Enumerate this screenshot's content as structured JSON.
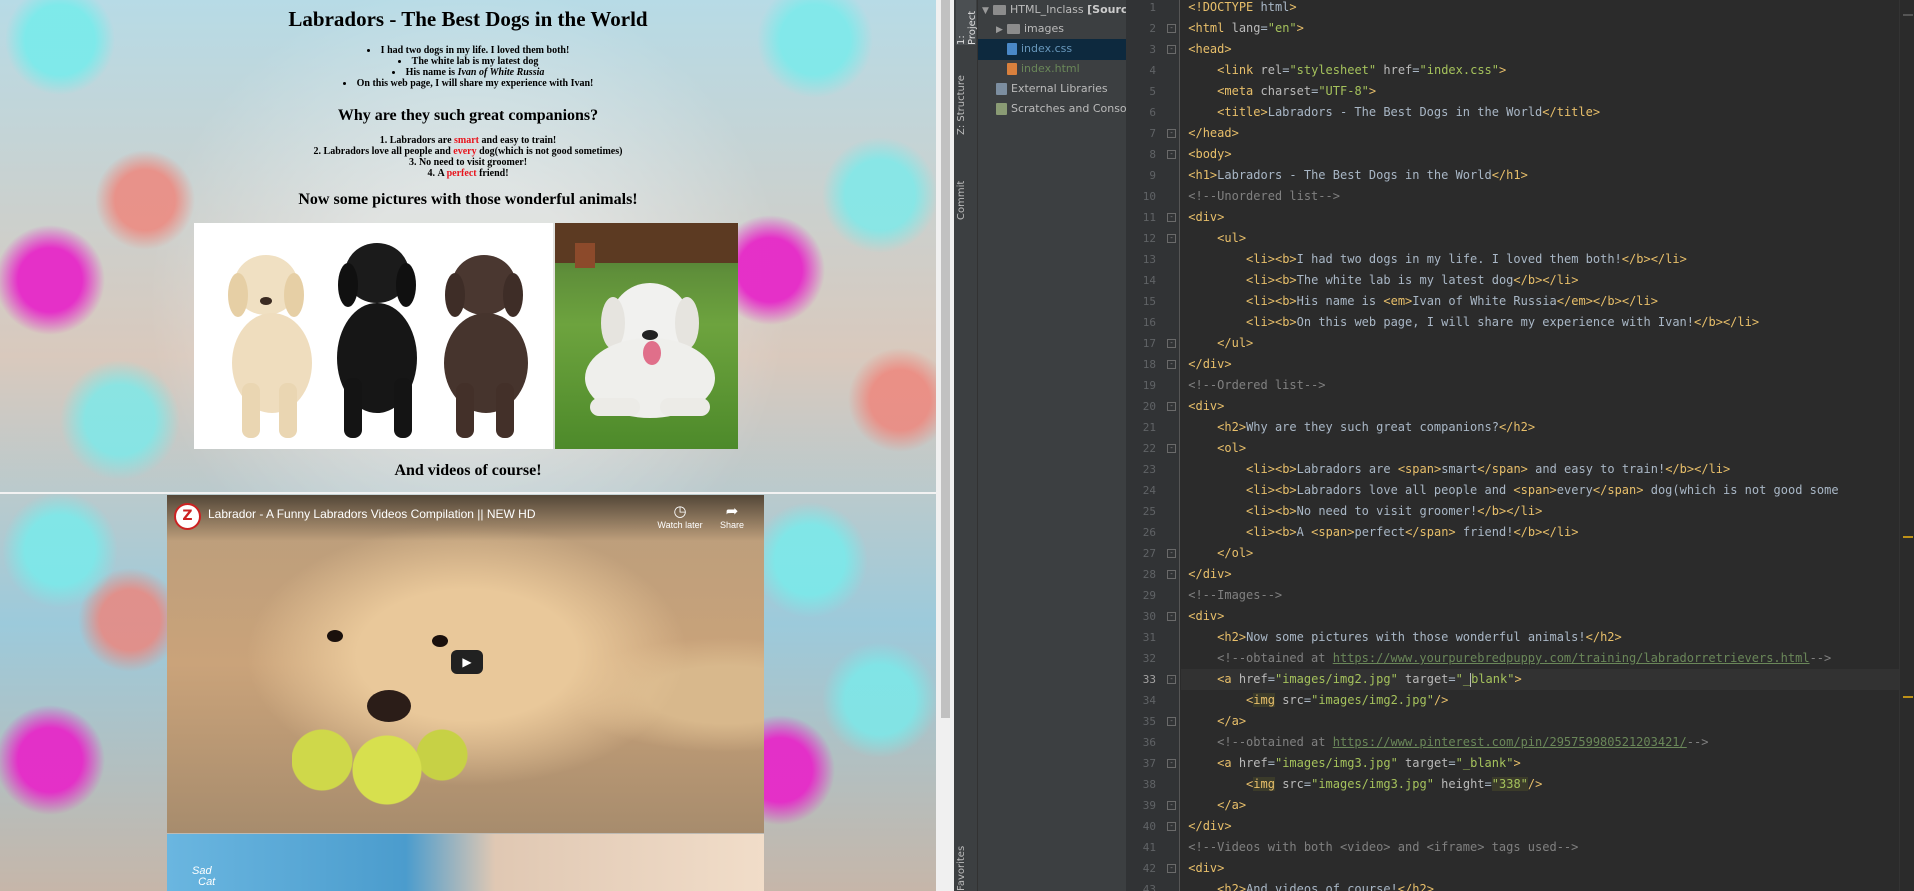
{
  "browser": {
    "h1": "Labradors - The Best Dogs in the World",
    "list": [
      {
        "pre": "I had two dogs in my life. I loved them both!",
        "em": "",
        "post": ""
      },
      {
        "pre": "The white lab is my latest dog",
        "em": "",
        "post": ""
      },
      {
        "pre": "His name is ",
        "em": "Ivan of White Russia",
        "post": ""
      },
      {
        "pre": "On this web page, I will share my experience with Ivan!",
        "em": "",
        "post": ""
      }
    ],
    "h2_companions": "Why are they such great companions?",
    "ordered": [
      {
        "pre": "Labradors are ",
        "red": "smart",
        "post": " and easy to train!"
      },
      {
        "pre": "Labradors love all people and ",
        "red": "every",
        "post": " dog(which is not good sometimes)"
      },
      {
        "pre": "No need to visit groomer!",
        "red": "",
        "post": ""
      },
      {
        "pre": "A ",
        "red": "perfect",
        "post": " friend!"
      }
    ],
    "h2_pictures": "Now some pictures with those wonderful animals!",
    "h2_videos": "And videos of course!",
    "video": {
      "title": "Labrador - A Funny Labradors Videos Compilation || NEW HD",
      "watch_later": "Watch later",
      "share": "Share",
      "second_video_text_1": "Sad",
      "second_video_text_2": "Cat"
    }
  },
  "ide": {
    "tool_windows": {
      "project": "1: Project",
      "structure": "Z: Structure",
      "commit": "Commit",
      "favorites": "Favorites"
    },
    "tree": {
      "root": "HTML_Inclass",
      "root_suffix": "[Sourc",
      "images": "images",
      "css": "index.css",
      "html": "index.html",
      "external": "External Libraries",
      "scratches": "Scratches and Conso"
    },
    "current_line": 33,
    "lines": [
      "<!DOCTYPE html>",
      "<html lang=\"en\">",
      "<head>",
      "    <link rel=\"stylesheet\" href=\"index.css\">",
      "    <meta charset=\"UTF-8\">",
      "    <title>Labradors - The Best Dogs in the World</title>",
      "</head>",
      "<body>",
      "<h1>Labradors - The Best Dogs in the World</h1>",
      "<!--Unordered list-->",
      "<div>",
      "    <ul>",
      "        <li><b>I had two dogs in my life. I loved them both!</b></li>",
      "        <li><b>The white lab is my latest dog</b></li>",
      "        <li><b>His name is <em>Ivan of White Russia</em></b></li>",
      "        <li><b>On this web page, I will share my experience with Ivan!</b></li>",
      "    </ul>",
      "</div>",
      "<!--Ordered list-->",
      "<div>",
      "    <h2>Why are they such great companions?</h2>",
      "    <ol>",
      "        <li><b>Labradors are <span>smart</span> and easy to train!</b></li>",
      "        <li><b>Labradors love all people and <span>every</span> dog(which is not good some",
      "        <li><b>No need to visit groomer!</b></li>",
      "        <li><b>A <span>perfect</span> friend!</b></li>",
      "    </ol>",
      "</div>",
      "<!--Images-->",
      "<div>",
      "    <h2>Now some pictures with those wonderful animals!</h2>",
      "    <!--obtained at https://www.yourpurebredpuppy.com/training/labradorretrievers.html-->",
      "    <a href=\"images/img2.jpg\" target=\"_blank\">",
      "        <img src=\"images/img2.jpg\"/>",
      "    </a>",
      "    <!--obtained at https://www.pinterest.com/pin/295759980521203421/-->",
      "    <a href=\"images/img3.jpg\" target=\"_blank\">",
      "        <img src=\"images/img3.jpg\" height=\"338\"/>",
      "    </a>",
      "</div>",
      "<!--Videos with both <video> and <iframe> tags used-->",
      "<div>",
      "    <h2>And videos of course!</h2>"
    ]
  },
  "colors": {
    "accent_red": "#e8141d",
    "ide_bg": "#2b2b2b",
    "tag": "#e8bf6a",
    "string": "#a5c25c",
    "comment": "#808080"
  }
}
